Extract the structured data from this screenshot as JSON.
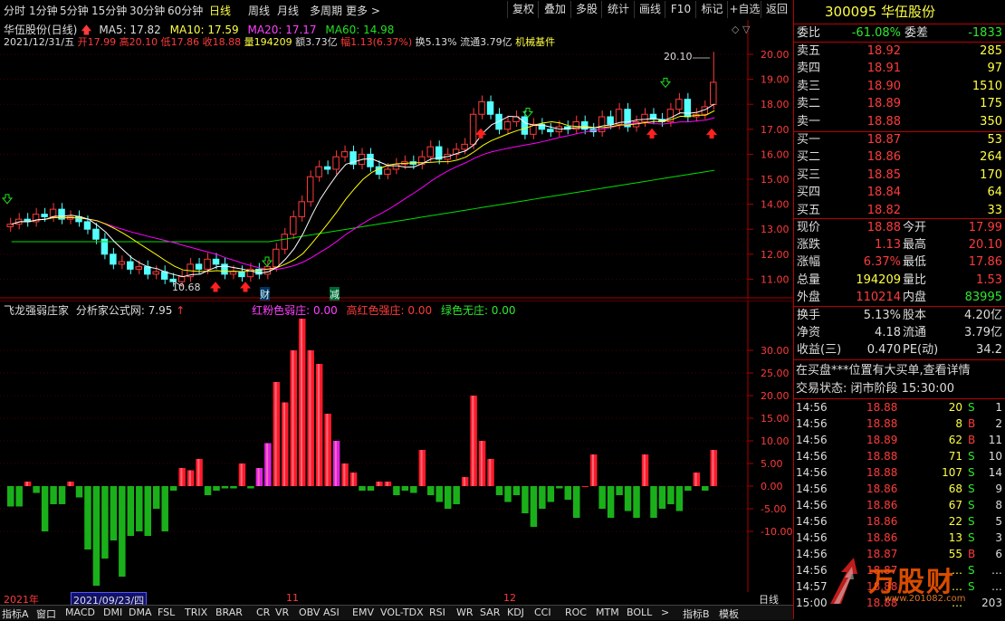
{
  "toolbar": {
    "periods": [
      "分时",
      "1分钟",
      "5分钟",
      "15分钟",
      "30分钟",
      "60分钟",
      "日线",
      "周线",
      "月线",
      "多周期",
      "更多 >"
    ],
    "selected": "日线",
    "buttons": [
      "复权",
      "叠加",
      "多股",
      "统计",
      "画线",
      "F10",
      "标记",
      "+自选",
      "返回"
    ]
  },
  "kline": {
    "title": "华伍股份(日线)",
    "ma5": "MA5: 17.82",
    "ma10": "MA10: 17.59",
    "ma20": "MA20: 17.17",
    "ma60": "MA60: 14.98",
    "info_date": "2021/12/31/五",
    "info_open": "开17.99",
    "info_high": "高20.10",
    "info_low": "低17.86",
    "info_close": "收18.88",
    "info_vol": "量194209",
    "info_amt": "额3.73亿",
    "info_chg": "幅1.13(6.37%)",
    "info_turn": "换5.13%",
    "info_float": "流通3.79亿",
    "info_sector": "机械基件",
    "high_label": "20.10",
    "low_label": "10.68",
    "note_cai": "财",
    "note_jian": "减",
    "y_ticks": [
      "20.00",
      "19.00",
      "18.00",
      "17.00",
      "16.00",
      "15.00",
      "14.00",
      "13.00",
      "12.00",
      "11.00"
    ],
    "colors": {
      "up": "#ff3b3b",
      "down": "#54ffff",
      "ma5": "#ffffff",
      "ma10": "#ffff00",
      "ma20": "#ff00ff",
      "ma60": "#00e000"
    }
  },
  "indicator": {
    "name": "飞龙强弱庄家",
    "source": "分析家公式网: 7.95",
    "legend_pink": "红粉色弱庄: 0.00",
    "legend_red": "高红色强庄: 0.00",
    "legend_green": "绿色无庄: 0.00",
    "y_ticks": [
      "30.00",
      "25.00",
      "20.00",
      "15.00",
      "10.00",
      "5.00",
      "0.00",
      "-5.00",
      "-10.00"
    ]
  },
  "chart_data": {
    "type": "bar",
    "title": "飞龙强弱庄家",
    "y_range": [
      -22,
      37
    ],
    "values": [
      -4.5,
      -4.5,
      1,
      -1.5,
      -10,
      -4,
      -4,
      1,
      -2.5,
      -14,
      -22,
      -16,
      -12,
      -20,
      -11,
      -10,
      -11,
      -5,
      -10,
      -1,
      4,
      3.5,
      6,
      -2,
      -1,
      -0.5,
      -0.5,
      5,
      -0.5,
      4,
      9.5,
      23,
      18.5,
      30,
      37,
      30,
      27,
      16,
      10,
      5,
      3,
      -1,
      -1,
      1,
      1,
      -2,
      -1,
      -1.5,
      8,
      -2,
      -3.5,
      -5,
      -4,
      2,
      20,
      10,
      6,
      -2,
      -3.5,
      -2,
      -6,
      -9,
      -5,
      -3.5,
      -0.5,
      -3,
      -7,
      0,
      7,
      -5,
      -7,
      -2,
      -5.5,
      -7,
      7,
      -7,
      -5,
      -4,
      -5.5,
      -1,
      3,
      -1,
      8
    ],
    "colors": {
      "red": "#ff1a2a",
      "pink": "#e020e0",
      "green": "#1ab01a"
    }
  },
  "dates": {
    "y2021": "2021年",
    "cursor": "2021/09/23/四",
    "m11": "11",
    "m12": "12",
    "period": "日线"
  },
  "tabs": [
    "指标A",
    "窗口",
    "MACD",
    "DMI",
    "DMA",
    "FSL",
    "TRIX",
    "BRAR",
    "CR",
    "VR",
    "OBV",
    "ASI",
    "EMV",
    "VOL-TDX",
    "RSI",
    "WR",
    "SAR",
    "KDJ",
    "CCI",
    "ROC",
    "MTM",
    "BOLL",
    ">",
    "指标B",
    "模板"
  ],
  "quote": {
    "code": "300095",
    "name": "华伍股份",
    "weibi_label": "委比",
    "weibi": "-61.08%",
    "weicha_label": "委差",
    "weicha": "-1833",
    "asks": [
      {
        "label": "卖五",
        "price": "18.92",
        "vol": "285"
      },
      {
        "label": "卖四",
        "price": "18.91",
        "vol": "97"
      },
      {
        "label": "卖三",
        "price": "18.90",
        "vol": "1510"
      },
      {
        "label": "卖二",
        "price": "18.89",
        "vol": "175"
      },
      {
        "label": "卖一",
        "price": "18.88",
        "vol": "350"
      }
    ],
    "bids": [
      {
        "label": "买一",
        "price": "18.87",
        "vol": "53"
      },
      {
        "label": "买二",
        "price": "18.86",
        "vol": "264"
      },
      {
        "label": "买三",
        "price": "18.85",
        "vol": "170"
      },
      {
        "label": "买四",
        "price": "18.84",
        "vol": "64"
      },
      {
        "label": "买五",
        "price": "18.82",
        "vol": "33"
      }
    ],
    "stats": [
      {
        "l1": "现价",
        "v1": "18.88",
        "c1": "red",
        "l2": "今开",
        "v2": "17.99",
        "c2": "red"
      },
      {
        "l1": "涨跌",
        "v1": "1.13",
        "c1": "red",
        "l2": "最高",
        "v2": "20.10",
        "c2": "red"
      },
      {
        "l1": "涨幅",
        "v1": "6.37%",
        "c1": "red",
        "l2": "最低",
        "v2": "17.86",
        "c2": "red"
      },
      {
        "l1": "总量",
        "v1": "194209",
        "c1": "yellow",
        "l2": "量比",
        "v2": "1.53",
        "c2": "red"
      },
      {
        "l1": "外盘",
        "v1": "110214",
        "c1": "red",
        "l2": "内盘",
        "v2": "83995",
        "c2": "green"
      }
    ],
    "stats2": [
      {
        "l1": "换手",
        "v1": "5.13%",
        "l2": "股本",
        "v2": "4.20亿"
      },
      {
        "l1": "净资",
        "v1": "4.18",
        "l2": "流通",
        "v2": "3.79亿"
      },
      {
        "l1": "收益(三)",
        "v1": "0.470",
        "l2": "PE(动)",
        "v2": "34.2"
      }
    ],
    "notice": "在买盘***位置有大买单,查看详情",
    "status": "交易状态: 闭市阶段 15:30:00",
    "ticks": [
      {
        "t": "14:56",
        "p": "18.88",
        "v": "20",
        "s": "S",
        "n": "1"
      },
      {
        "t": "14:56",
        "p": "18.88",
        "v": "8",
        "s": "B",
        "n": "2"
      },
      {
        "t": "14:56",
        "p": "18.89",
        "v": "62",
        "s": "B",
        "n": "11"
      },
      {
        "t": "14:56",
        "p": "18.88",
        "v": "71",
        "s": "S",
        "n": "10"
      },
      {
        "t": "14:56",
        "p": "18.88",
        "v": "107",
        "s": "S",
        "n": "14"
      },
      {
        "t": "14:56",
        "p": "18.86",
        "v": "68",
        "s": "S",
        "n": "9"
      },
      {
        "t": "14:56",
        "p": "18.86",
        "v": "67",
        "s": "S",
        "n": "8"
      },
      {
        "t": "14:56",
        "p": "18.86",
        "v": "22",
        "s": "S",
        "n": "5"
      },
      {
        "t": "14:56",
        "p": "18.86",
        "v": "13",
        "s": "S",
        "n": "3"
      },
      {
        "t": "14:56",
        "p": "18.87",
        "v": "55",
        "s": "B",
        "n": "6"
      },
      {
        "t": "14:56",
        "p": "18.87",
        "v": "…",
        "s": "S",
        "n": "…"
      },
      {
        "t": "14:57",
        "p": "18.88",
        "v": "…",
        "s": "S",
        "n": "…"
      },
      {
        "t": "15:00",
        "p": "18.88",
        "v": "…",
        "s": "",
        "n": "203"
      }
    ],
    "watermark": "万股财",
    "watermark_url": "www.201082.com"
  }
}
